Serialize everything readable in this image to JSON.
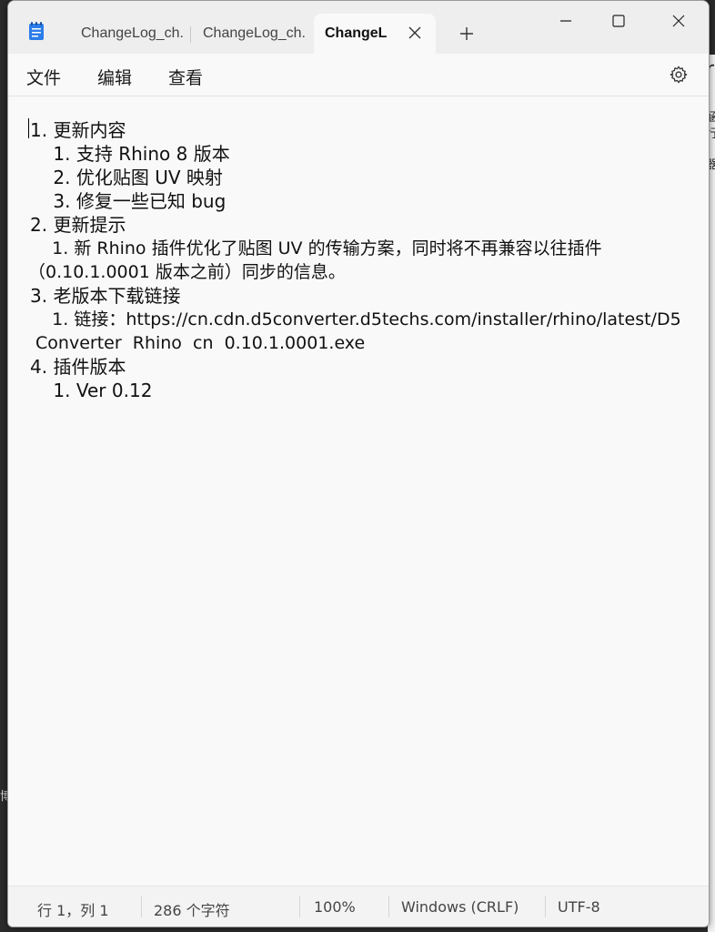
{
  "titlebar": {
    "tabs": [
      {
        "label": "ChangeLog_ch."
      },
      {
        "label": "ChangeLog_ch."
      },
      {
        "label": "ChangeL"
      }
    ]
  },
  "menu": {
    "file": "文件",
    "edit": "编辑",
    "view": "查看"
  },
  "editor": {
    "lines": [
      "1. 更新内容",
      "    1. 支持 Rhino 8 版本",
      "    2. 优化贴图 UV 映射",
      "    3. 修复一些已知 bug",
      "2. 更新提示",
      "    1. 新 Rhino 插件优化了贴图 UV 的传输方案，同时将不再兼容以往插件",
      "（0.10.1.0001 版本之前）同步的信息。",
      "3. 老版本下载链接",
      "    1. 链接：https://cn.cdn.d5converter.d5techs.com/installer/rhino/latest/D5",
      " Converter  Rhino  cn  0.10.1.0001.exe",
      "4. 插件版本",
      "    1. Ver 0.12"
    ]
  },
  "statusbar": {
    "position": "行 1，列 1",
    "char_count": "286 个字符",
    "zoom": "100%",
    "line_ending": "Windows (CRLF)",
    "encoding": "UTF-8"
  },
  "background": {
    "chars": [
      "r",
      "涵",
      "行",
      "器",
      "博"
    ]
  },
  "colors": {
    "app_icon": "#2b7de9",
    "window_bg": "#f9f9f9",
    "titlebar_bg": "#eeeeee",
    "statusbar_bg": "#f3f3f3"
  }
}
